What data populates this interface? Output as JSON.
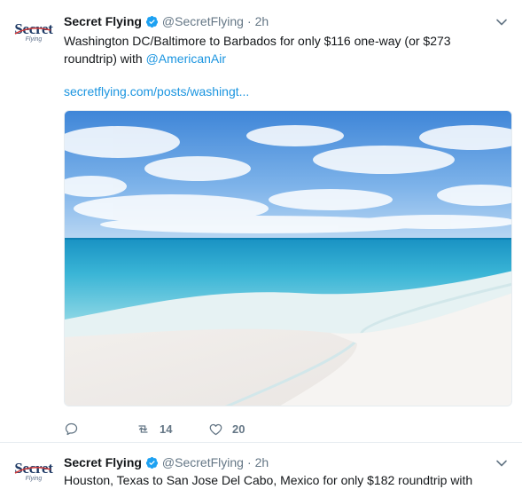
{
  "tweets": [
    {
      "avatar": {
        "wordmark": "Secret",
        "sub": "Flying"
      },
      "name": "Secret Flying",
      "handle": "@SecretFlying",
      "separator": "·",
      "time": "2h",
      "text_before": "Washington DC/Baltimore to Barbados for only $116 one-way (or $273 roundtrip) with ",
      "mention": "@AmericanAir",
      "link": "secretflying.com/posts/washingt...",
      "actions": {
        "retweets": "14",
        "likes": "20"
      }
    },
    {
      "avatar": {
        "wordmark": "Secret",
        "sub": "Flying"
      },
      "name": "Secret Flying",
      "handle": "@SecretFlying",
      "separator": "·",
      "time": "2h",
      "text": "Houston, Texas to San Jose Del Cabo, Mexico for only $182 roundtrip with"
    }
  ],
  "colors": {
    "link": "#1b95e0",
    "verified": "#1da1f2",
    "meta": "#657786",
    "brand": "#1f3b66"
  }
}
